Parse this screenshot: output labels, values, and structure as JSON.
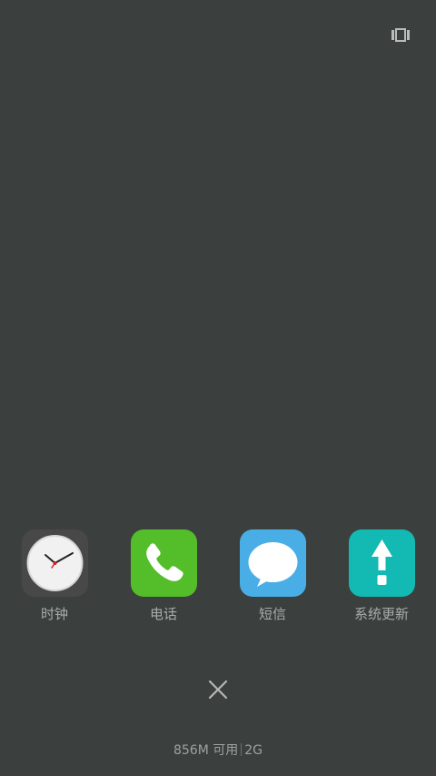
{
  "top_bar": {
    "view_toggle_icon": "card-stack-icon"
  },
  "recent_apps": [
    {
      "label": "时钟",
      "icon": "clock-icon",
      "color": "#484848"
    },
    {
      "label": "电话",
      "icon": "phone-icon",
      "color": "#53bd2a"
    },
    {
      "label": "短信",
      "icon": "message-bubble-icon",
      "color": "#4aaee6"
    },
    {
      "label": "系统更新",
      "icon": "update-arrow-icon",
      "color": "#13b9b3"
    }
  ],
  "close_all": {
    "icon": "close-icon"
  },
  "memory": {
    "available": "856M 可用",
    "total": "2G"
  },
  "colors": {
    "background": "#3b3f3d",
    "label_text": "#a8acaa"
  }
}
